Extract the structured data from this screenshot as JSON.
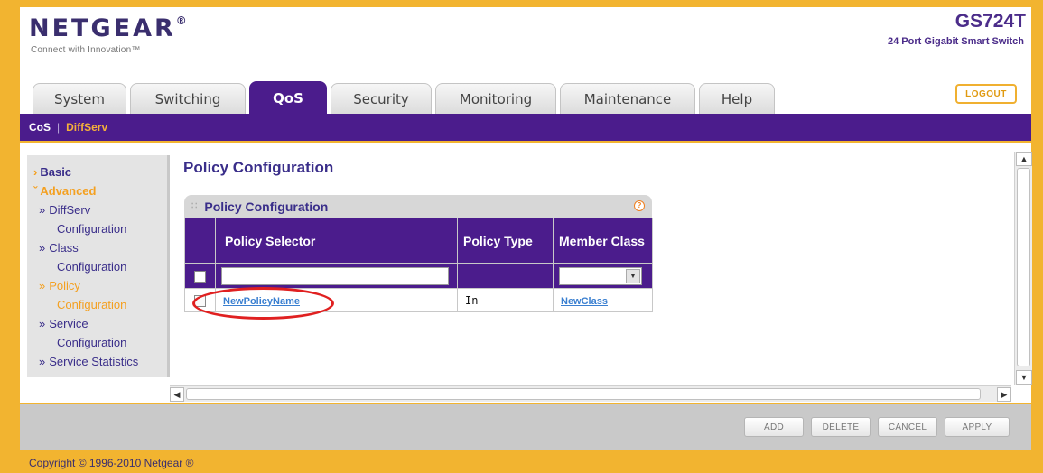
{
  "header": {
    "brand": "NETGEAR",
    "brand_mark": "®",
    "tagline": "Connect with Innovation™",
    "model": "GS724T",
    "model_desc": "24 Port Gigabit Smart Switch",
    "logout_label": "LOGOUT"
  },
  "tabs": [
    {
      "label": "System"
    },
    {
      "label": "Switching"
    },
    {
      "label": "QoS",
      "active": true
    },
    {
      "label": "Security"
    },
    {
      "label": "Monitoring"
    },
    {
      "label": "Maintenance"
    },
    {
      "label": "Help"
    }
  ],
  "subnav": {
    "cos": "CoS",
    "separator": "|",
    "diffserv": "DiffServ"
  },
  "sidebar": {
    "basic": "Basic",
    "advanced": "Advanced",
    "items": [
      {
        "line1": "DiffServ",
        "line2": "Configuration"
      },
      {
        "line1": "Class",
        "line2": "Configuration"
      },
      {
        "line1": "Policy",
        "line2": "Configuration"
      },
      {
        "line1": "Service",
        "line2": "Configuration"
      },
      {
        "line1": "Service Statistics",
        "line2": ""
      }
    ]
  },
  "page": {
    "title": "Policy Configuration"
  },
  "panel": {
    "title": "Policy Configuration",
    "help_glyph": "?",
    "columns": [
      "Policy Selector",
      "Policy Type",
      "Member Class"
    ],
    "input_row": {
      "policy_selector_value": "",
      "member_class_value": ""
    },
    "rows": [
      {
        "policy_selector": "NewPolicyName",
        "policy_type": "In",
        "member_class": "NewClass"
      }
    ]
  },
  "buttons": {
    "add": "ADD",
    "delete": "DELETE",
    "cancel": "CANCEL",
    "apply": "APPLY"
  },
  "footer": {
    "copyright": "Copyright © 1996-2010 Netgear ®"
  },
  "colors": {
    "brand_purple": "#4b1c8c",
    "accent_orange": "#f4a020",
    "frame_gold": "#f2b430",
    "link_blue": "#3a7fd0"
  },
  "icons": {
    "help": "question-icon",
    "scroll_up": "chevron-up-icon",
    "scroll_down": "chevron-down-icon",
    "scroll_left": "chevron-left-icon",
    "scroll_right": "chevron-right-icon"
  }
}
